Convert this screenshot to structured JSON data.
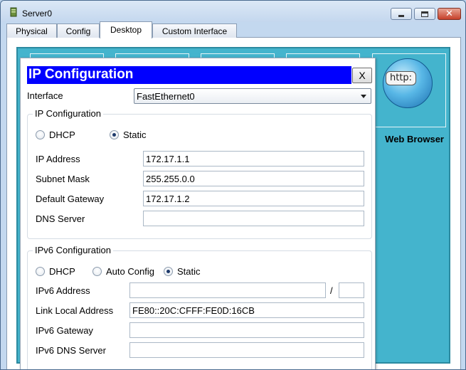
{
  "window": {
    "title": "Server0"
  },
  "tabs": [
    "Physical",
    "Config",
    "Desktop",
    "Custom Interface"
  ],
  "desktop": {
    "browser_label": "Web Browser",
    "browser_icon_text": "http:"
  },
  "dialog": {
    "title": "IP Configuration",
    "close_label": "X",
    "interface_label": "Interface",
    "interface_value": "FastEthernet0",
    "ipv4": {
      "group_title": "IP Configuration",
      "dhcp_label": "DHCP",
      "static_label": "Static",
      "selected_mode": "Static",
      "ip_address_label": "IP Address",
      "ip_address": "172.17.1.1",
      "subnet_mask_label": "Subnet Mask",
      "subnet_mask": "255.255.0.0",
      "gateway_label": "Default Gateway",
      "gateway": "172.17.1.2",
      "dns_label": "DNS Server",
      "dns": ""
    },
    "ipv6": {
      "group_title": "IPv6 Configuration",
      "dhcp_label": "DHCP",
      "auto_label": "Auto Config",
      "static_label": "Static",
      "selected_mode": "Static",
      "address_label": "IPv6 Address",
      "address": "",
      "prefix_separator": "/",
      "prefix": "",
      "link_local_label": "Link Local Address",
      "link_local": "FE80::20C:CFFF:FE0D:16CB",
      "gateway_label": "IPv6 Gateway",
      "gateway": "",
      "dns_label": "IPv6 DNS Server",
      "dns": ""
    }
  },
  "colors": {
    "dialog_title_bg": "#0000ff",
    "desktop_bg": "#44b4cd"
  },
  "icons": {
    "app": "server-icon",
    "window_min": "minimize-icon",
    "window_max": "maximize-icon",
    "window_close": "close-icon",
    "browser": "globe-icon"
  }
}
